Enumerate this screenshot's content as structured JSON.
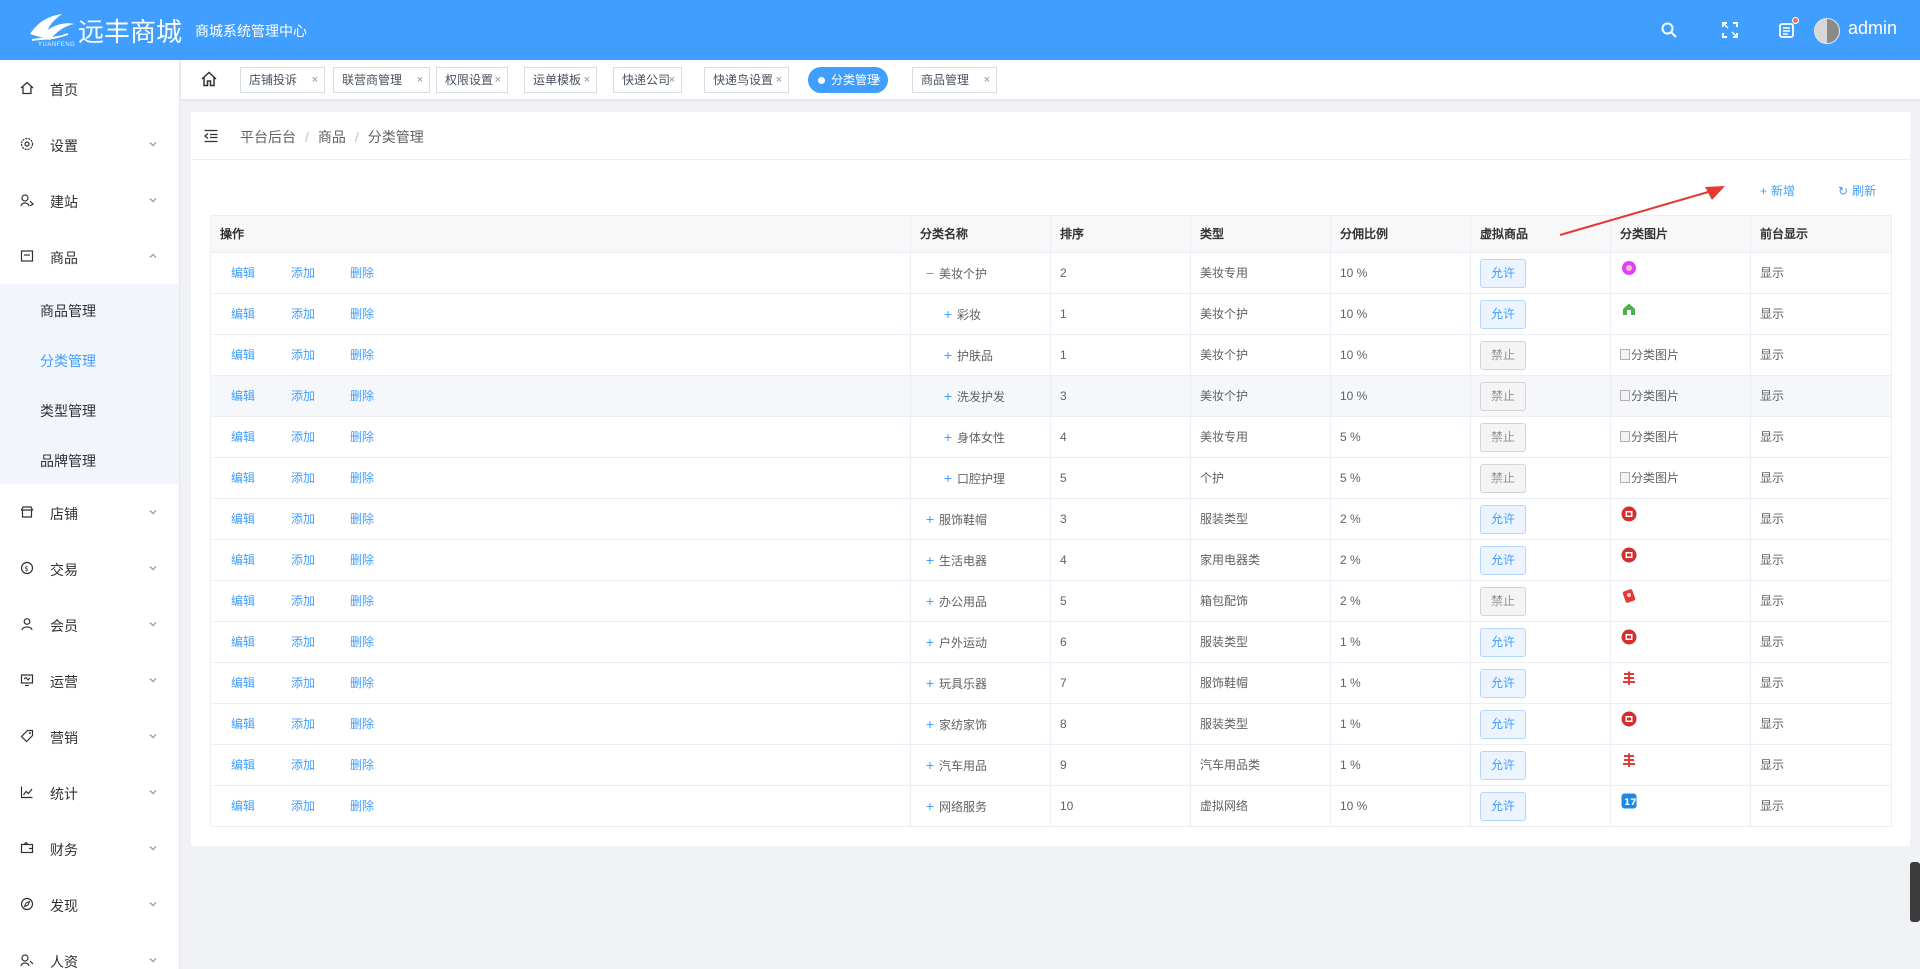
{
  "header": {
    "logo_text": "远丰商城",
    "logo_sub": "YUANFENG",
    "subtitle": "商城系统管理中心",
    "username": "admin",
    "icons": [
      "search-icon",
      "fullscreen-icon",
      "message-icon"
    ]
  },
  "sidebar": {
    "items": [
      {
        "label": "首页",
        "icon": "home-icon"
      },
      {
        "label": "设置",
        "icon": "gear-icon"
      },
      {
        "label": "建站",
        "icon": "site-icon"
      },
      {
        "label": "商品",
        "icon": "goods-icon"
      },
      {
        "label": "店铺",
        "icon": "store-icon"
      },
      {
        "label": "交易",
        "icon": "trade-icon"
      },
      {
        "label": "会员",
        "icon": "user-icon"
      },
      {
        "label": "运营",
        "icon": "operation-icon"
      },
      {
        "label": "营销",
        "icon": "tag-icon"
      },
      {
        "label": "统计",
        "icon": "chart-icon"
      },
      {
        "label": "财务",
        "icon": "finance-icon"
      },
      {
        "label": "发现",
        "icon": "compass-icon"
      },
      {
        "label": "人资",
        "icon": "hr-icon"
      }
    ],
    "sub_items": [
      {
        "label": "商品管理"
      },
      {
        "label": "分类管理",
        "active": true
      },
      {
        "label": "类型管理"
      },
      {
        "label": "品牌管理"
      }
    ]
  },
  "tabs": [
    {
      "label": "店铺投诉"
    },
    {
      "label": "联营商管理"
    },
    {
      "label": "权限设置"
    },
    {
      "label": "运单模板"
    },
    {
      "label": "快递公司"
    },
    {
      "label": "快递鸟设置"
    },
    {
      "label": "分类管理",
      "active": true
    },
    {
      "label": "商品管理"
    }
  ],
  "breadcrumb": [
    "平台后台",
    "商品",
    "分类管理"
  ],
  "toolbar": {
    "add_label": "新增",
    "refresh_label": "刷新"
  },
  "table": {
    "columns": [
      "操作",
      "分类名称",
      "排序",
      "类型",
      "分佣比例",
      "虚拟商品",
      "分类图片",
      "前台显示"
    ],
    "op_labels": {
      "edit": "编辑",
      "add": "添加",
      "delete": "删除"
    },
    "broken_img_text": "分类图片",
    "rows": [
      {
        "name": "美妆个护",
        "toggle": "−",
        "child": false,
        "sort": "2",
        "type": "美妆专用",
        "ratio": "10 %",
        "virtual": "允许",
        "img": "circle-pink",
        "show": "显示"
      },
      {
        "name": "彩妆",
        "toggle": "+",
        "child": true,
        "sort": "1",
        "type": "美妆个护",
        "ratio": "10 %",
        "virtual": "允许",
        "img": "house-green",
        "show": "显示"
      },
      {
        "name": "护肤品",
        "toggle": "+",
        "child": true,
        "sort": "1",
        "type": "美妆个护",
        "ratio": "10 %",
        "virtual": "禁止",
        "img": "broken",
        "show": "显示"
      },
      {
        "name": "洗发护发",
        "toggle": "+",
        "child": true,
        "sort": "3",
        "type": "美妆个护",
        "ratio": "10 %",
        "virtual": "禁止",
        "img": "broken",
        "show": "显示"
      },
      {
        "name": "身体女性",
        "toggle": "+",
        "child": true,
        "sort": "4",
        "type": "美妆专用",
        "ratio": "5 %",
        "virtual": "禁止",
        "img": "broken",
        "show": "显示"
      },
      {
        "name": "口腔护理",
        "toggle": "+",
        "child": true,
        "sort": "5",
        "type": "个护",
        "ratio": "5 %",
        "virtual": "禁止",
        "img": "broken",
        "show": "显示"
      },
      {
        "name": "服饰鞋帽",
        "toggle": "+",
        "child": false,
        "sort": "3",
        "type": "服装类型",
        "ratio": "2 %",
        "virtual": "允许",
        "img": "red-badge",
        "show": "显示"
      },
      {
        "name": "生活电器",
        "toggle": "+",
        "child": false,
        "sort": "4",
        "type": "家用电器类",
        "ratio": "2 %",
        "virtual": "允许",
        "img": "red-badge",
        "show": "显示"
      },
      {
        "name": "办公用品",
        "toggle": "+",
        "child": false,
        "sort": "5",
        "type": "箱包配饰",
        "ratio": "2 %",
        "virtual": "禁止",
        "img": "red-packet",
        "show": "显示"
      },
      {
        "name": "户外运动",
        "toggle": "+",
        "child": false,
        "sort": "6",
        "type": "服装类型",
        "ratio": "1 %",
        "virtual": "允许",
        "img": "red-badge",
        "show": "显示"
      },
      {
        "name": "玩具乐器",
        "toggle": "+",
        "child": false,
        "sort": "7",
        "type": "服饰鞋帽",
        "ratio": "1 %",
        "virtual": "允许",
        "img": "red-feng",
        "show": "显示"
      },
      {
        "name": "家纺家饰",
        "toggle": "+",
        "child": false,
        "sort": "8",
        "type": "服装类型",
        "ratio": "1 %",
        "virtual": "允许",
        "img": "red-badge",
        "show": "显示"
      },
      {
        "name": "汽车用品",
        "toggle": "+",
        "child": false,
        "sort": "9",
        "type": "汽车用品类",
        "ratio": "1 %",
        "virtual": "允许",
        "img": "red-feng",
        "show": "显示"
      },
      {
        "name": "网络服务",
        "toggle": "+",
        "child": false,
        "sort": "10",
        "type": "虚拟网络",
        "ratio": "10 %",
        "virtual": "允许",
        "img": "blue-17",
        "show": "显示"
      }
    ]
  },
  "colors": {
    "primary": "#409eff",
    "header": "#409eff",
    "annotation_arrow": "#e53935"
  }
}
